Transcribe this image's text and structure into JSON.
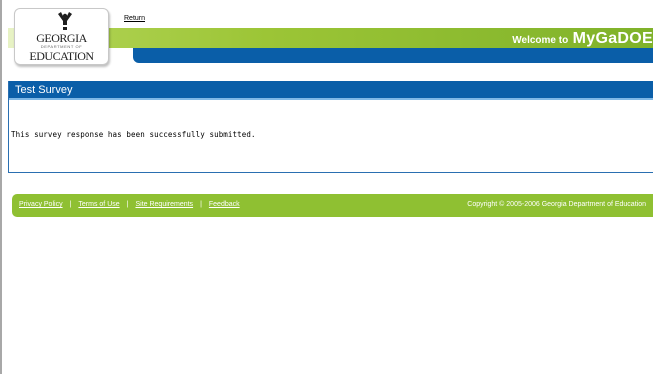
{
  "header": {
    "logo": {
      "line1": "GEORGIA",
      "line2": "DEPARTMENT OF",
      "line3": "EDUCATION"
    },
    "return_label": "Return",
    "welcome_prefix": "Welcome to",
    "welcome_brand": "MyGaDOE"
  },
  "panel": {
    "title": "Test Survey",
    "message": "This survey response has been successfully submitted."
  },
  "footer": {
    "links": [
      "Privacy Policy",
      "Terms of Use",
      "Site Requirements",
      "Feedback"
    ],
    "separator": "|",
    "copyright": "Copyright © 2005-2006 Georgia Department of Education"
  },
  "colors": {
    "brand_green": "#8fc032",
    "brand_blue": "#0a5ea8"
  }
}
